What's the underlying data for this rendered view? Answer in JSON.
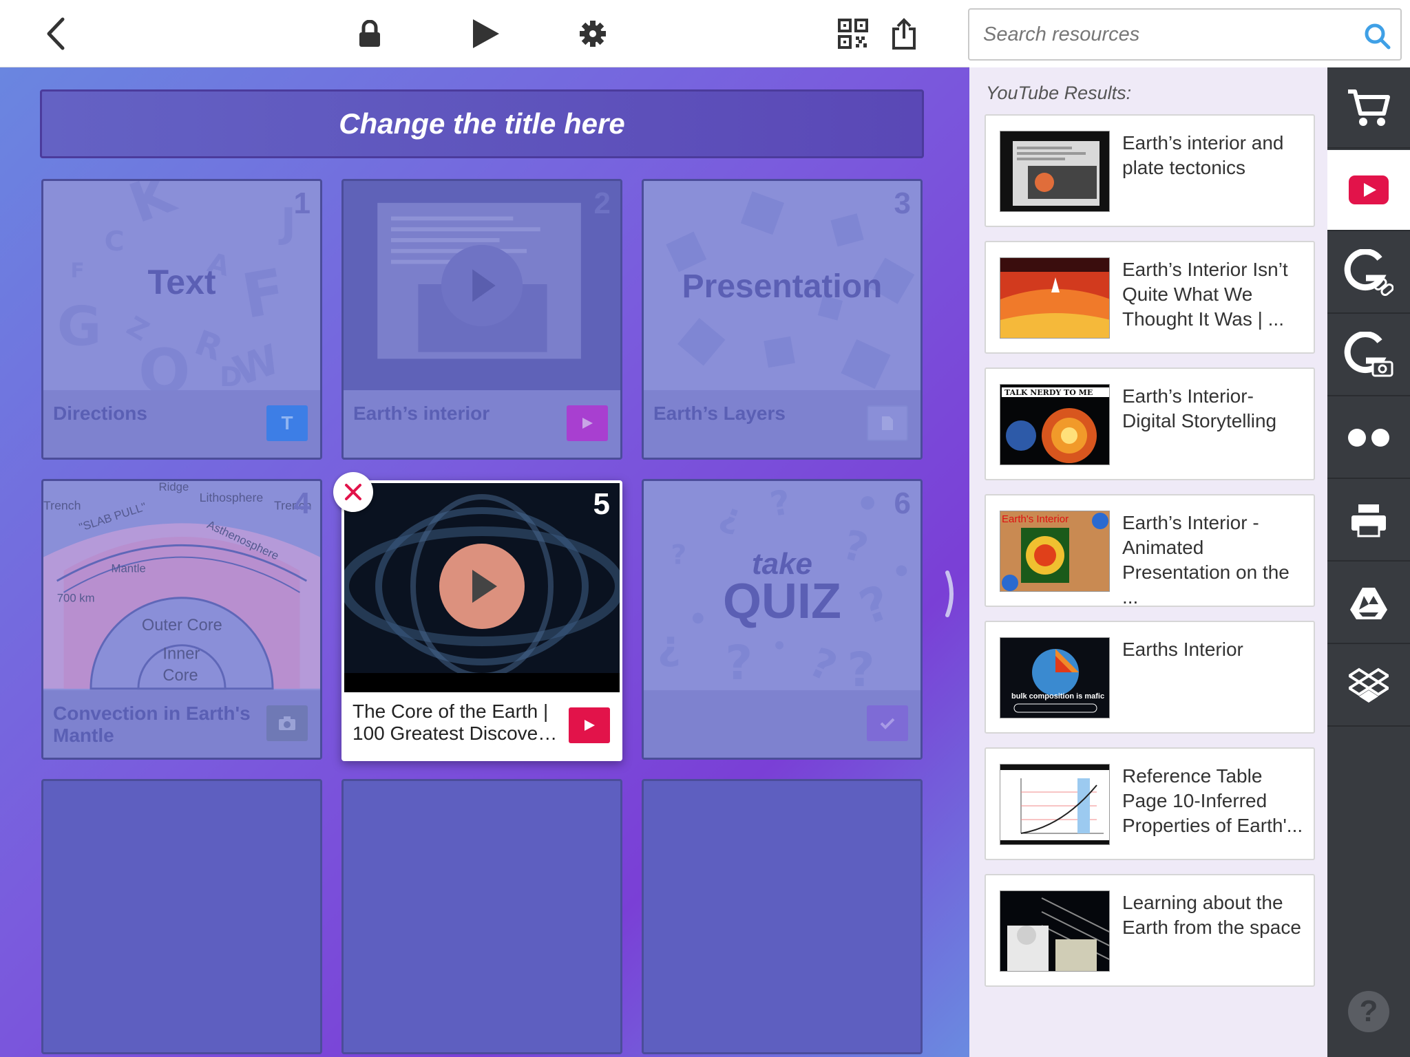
{
  "search": {
    "placeholder": "Search resources"
  },
  "board": {
    "title": "Change the title here",
    "tiles": [
      {
        "number": "1",
        "word": "Text",
        "caption": "Directions",
        "badge": "T",
        "badge_color": "#3d7ee6"
      },
      {
        "number": "2",
        "caption": "Earth’s interior",
        "badge_color": "#a83fd0"
      },
      {
        "number": "3",
        "word": "Presentation",
        "caption": "Earth’s Layers",
        "badge_color": "#8a8fd8"
      },
      {
        "number": "4",
        "caption": "Convection in Earth's Mantle",
        "badge_color": "#6f79b5",
        "diagram_labels": [
          "Ridge",
          "Trench",
          "\"SLAB PULL\"",
          "Lithosphere",
          "Trench",
          "Asthenosphere",
          "Mantle",
          "700 km",
          "Outer Core",
          "Inner",
          "Core"
        ]
      },
      {
        "number": "5",
        "caption": "The Core of the Earth | 100 Greatest Discove…",
        "badge_color": "#e2134a"
      },
      {
        "number": "6",
        "word_top": "take",
        "word_bottom": "QUIZ",
        "caption": "",
        "badge_color": "#7e6bd6"
      }
    ]
  },
  "results": {
    "heading": "YouTube Results:",
    "items": [
      {
        "title": "Earth’s interior and plate tectonics"
      },
      {
        "title": "Earth’s Interior Isn’t Quite What We Thought It Was | ..."
      },
      {
        "title": "Earth’s Interior- Digital Storytelling",
        "thumb_text": "TALK NERDY TO ME"
      },
      {
        "title": "Earth’s Interior - Animated Presentation on the ...",
        "thumb_text": "Earth's Interior"
      },
      {
        "title": "Earths Interior",
        "thumb_text": "bulk composition is mafic"
      },
      {
        "title": "Reference Table Page 10-Inferred Properties of Earth'..."
      },
      {
        "title": "Learning about the Earth from the space"
      }
    ]
  },
  "rail": {
    "items": [
      "cart-icon",
      "youtube-icon",
      "google-link-icon",
      "google-image-icon",
      "flickr-icon",
      "printer-icon",
      "google-drive-icon",
      "dropbox-icon"
    ],
    "help_label": "?"
  },
  "colors": {
    "accent": "#3fa0e6",
    "youtube": "#e2134a",
    "rail": "#383b40"
  }
}
